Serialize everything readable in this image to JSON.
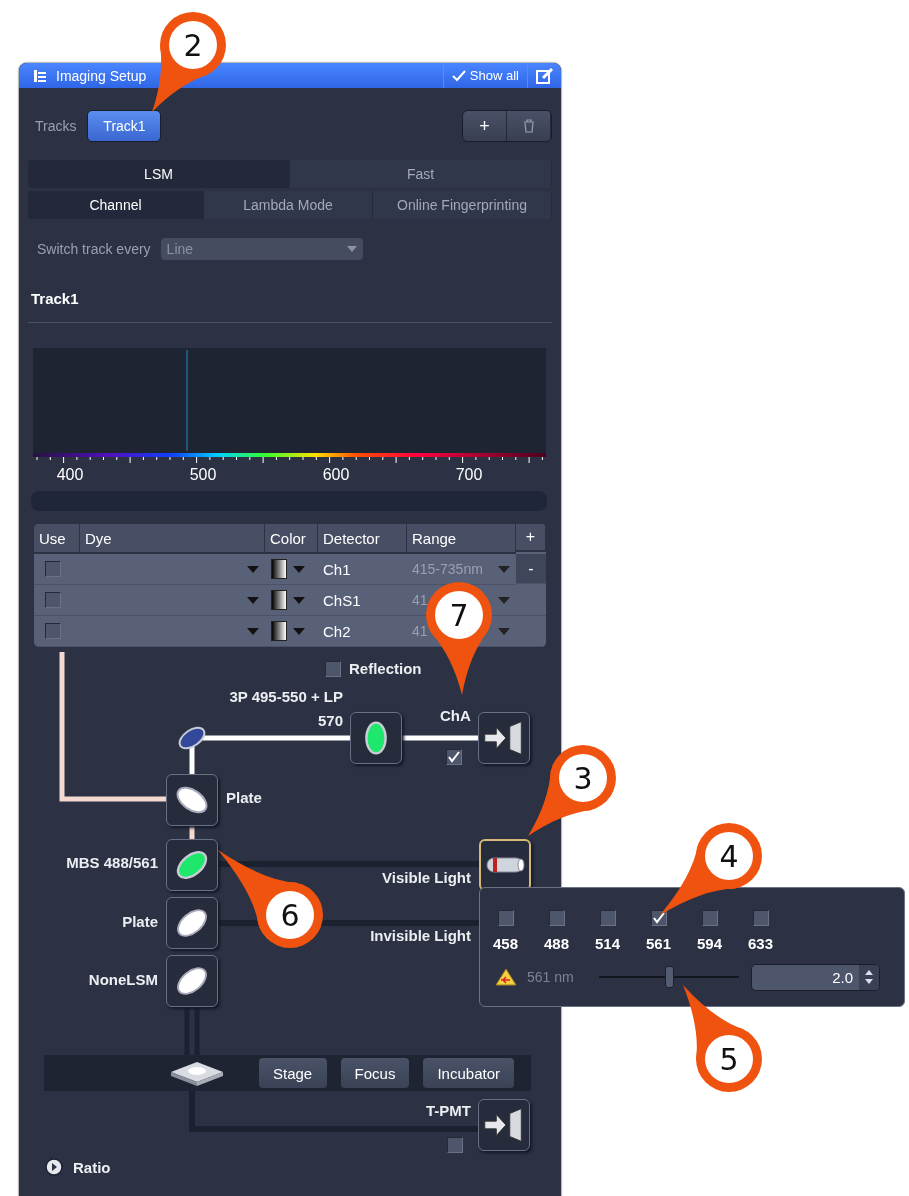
{
  "window": {
    "title": "Imaging Setup",
    "show_all": "Show all"
  },
  "tracks": {
    "label": "Tracks",
    "items": [
      {
        "label": "Track1",
        "selected": true
      }
    ],
    "add": "+"
  },
  "mode_tabs": [
    {
      "label": "LSM",
      "selected": true
    },
    {
      "label": "Fast",
      "selected": false
    }
  ],
  "sub_tabs": [
    {
      "label": "Channel",
      "selected": true
    },
    {
      "label": "Lambda Mode",
      "selected": false
    },
    {
      "label": "Online Fingerprinting",
      "selected": false
    }
  ],
  "switch_track": {
    "label": "Switch track every",
    "value": "Line"
  },
  "track_heading": "Track1",
  "spectrum": {
    "ticks": [
      "400",
      "500",
      "600",
      "700"
    ]
  },
  "channel_table": {
    "columns": [
      "Use",
      "Dye",
      "Color",
      "Detector",
      "Range"
    ],
    "add": "+",
    "remove": "-",
    "rows": [
      {
        "use": false,
        "detector": "Ch1",
        "range": "415-735nm"
      },
      {
        "use": false,
        "detector": "ChS1",
        "range": "41"
      },
      {
        "use": false,
        "detector": "Ch2",
        "range": "41"
      }
    ]
  },
  "light_path": {
    "reflection": {
      "label": "Reflection",
      "checked": false
    },
    "filter_label": [
      "3P 495-550 + LP",
      "570"
    ],
    "channel": {
      "label": "ChA",
      "checked": true
    },
    "plate_upper": "Plate",
    "mbs": "MBS 488/561",
    "plate_lower": "Plate",
    "none": "NoneLSM",
    "visible": "Visible Light",
    "invisible": "Invisible Light",
    "buttons": [
      "Stage",
      "Focus",
      "Incubator"
    ],
    "tpmt": {
      "label": "T-PMT",
      "checked": false
    }
  },
  "lasers": {
    "lines": [
      {
        "label": "458",
        "checked": false
      },
      {
        "label": "488",
        "checked": false
      },
      {
        "label": "514",
        "checked": false
      },
      {
        "label": "561",
        "checked": true
      },
      {
        "label": "594",
        "checked": false
      },
      {
        "label": "633",
        "checked": false
      }
    ],
    "line_label": "561 nm",
    "level": 0.5,
    "value": "2.0"
  },
  "ratio": "Ratio",
  "callouts": [
    {
      "label": "2"
    },
    {
      "label": "7"
    },
    {
      "label": "3"
    },
    {
      "label": "4"
    },
    {
      "label": "6"
    },
    {
      "label": "5"
    }
  ]
}
